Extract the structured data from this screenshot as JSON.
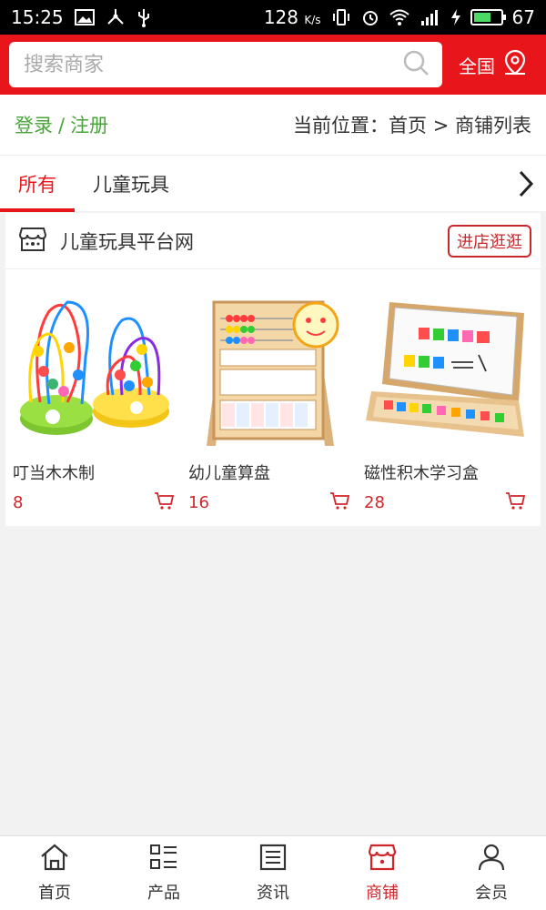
{
  "status_bar": {
    "time": "15:25",
    "net_speed": "128",
    "net_unit": "K/s",
    "battery": "67",
    "battery_level": 0.67
  },
  "search": {
    "placeholder": "搜索商家",
    "region_label": "全国"
  },
  "breadcrumb": {
    "login": "登录",
    "separator": "/",
    "register": "注册",
    "location": "当前位置：首页 > 商铺列表"
  },
  "tabs": [
    {
      "label": "所有",
      "active": true
    },
    {
      "label": "儿童玩具",
      "active": false
    }
  ],
  "shop": {
    "name": "儿童玩具平台网",
    "enter_label": "进店逛逛",
    "products": [
      {
        "name": "叮当木木制",
        "price": "8"
      },
      {
        "name": "幼儿童算盘",
        "price": "16"
      },
      {
        "name": "磁性积木学习盒",
        "price": "28"
      }
    ]
  },
  "bottom_nav": [
    {
      "label": "首页",
      "icon": "home-icon",
      "active": false
    },
    {
      "label": "产品",
      "icon": "grid-list-icon",
      "active": false
    },
    {
      "label": "资讯",
      "icon": "news-icon",
      "active": false
    },
    {
      "label": "商铺",
      "icon": "store-icon",
      "active": true
    },
    {
      "label": "会员",
      "icon": "user-icon",
      "active": false
    }
  ],
  "colors": {
    "brand_red": "#e8151b",
    "price_red": "#d0262b",
    "login_green": "#49a43a"
  }
}
